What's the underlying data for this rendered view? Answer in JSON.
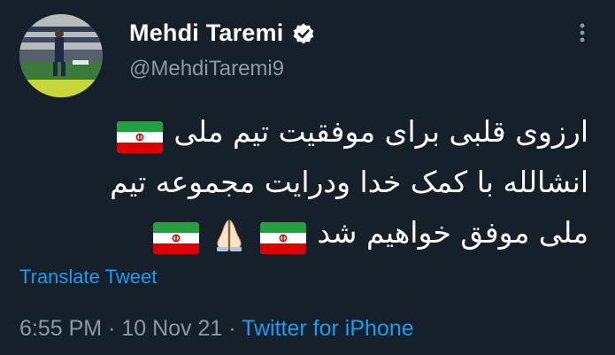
{
  "author": {
    "display_name": "Mehdi Taremi",
    "handle": "@MehdiTaremi9",
    "verified": true
  },
  "menu_icon": "more-vertical-icon",
  "tweet": {
    "line1": "ارزوی قلبی برای موفقیت تیم ملی",
    "line2": "انشالله با کمک خدا ودرایت مجموعه تیم",
    "line3": "ملی موفق خواهیم شد",
    "emoji": [
      "flag-iran",
      "flag-iran",
      "folded-hands",
      "flag-iran"
    ]
  },
  "translate_label": "Translate Tweet",
  "meta": {
    "time": "6:55 PM",
    "separator": "·",
    "date": "10 Nov 21",
    "source": "Twitter for iPhone"
  },
  "colors": {
    "background": "#15202b",
    "accent": "#1d9bf0",
    "muted": "#8b98a5",
    "flag_green": "#239f40",
    "flag_red": "#da0000"
  }
}
